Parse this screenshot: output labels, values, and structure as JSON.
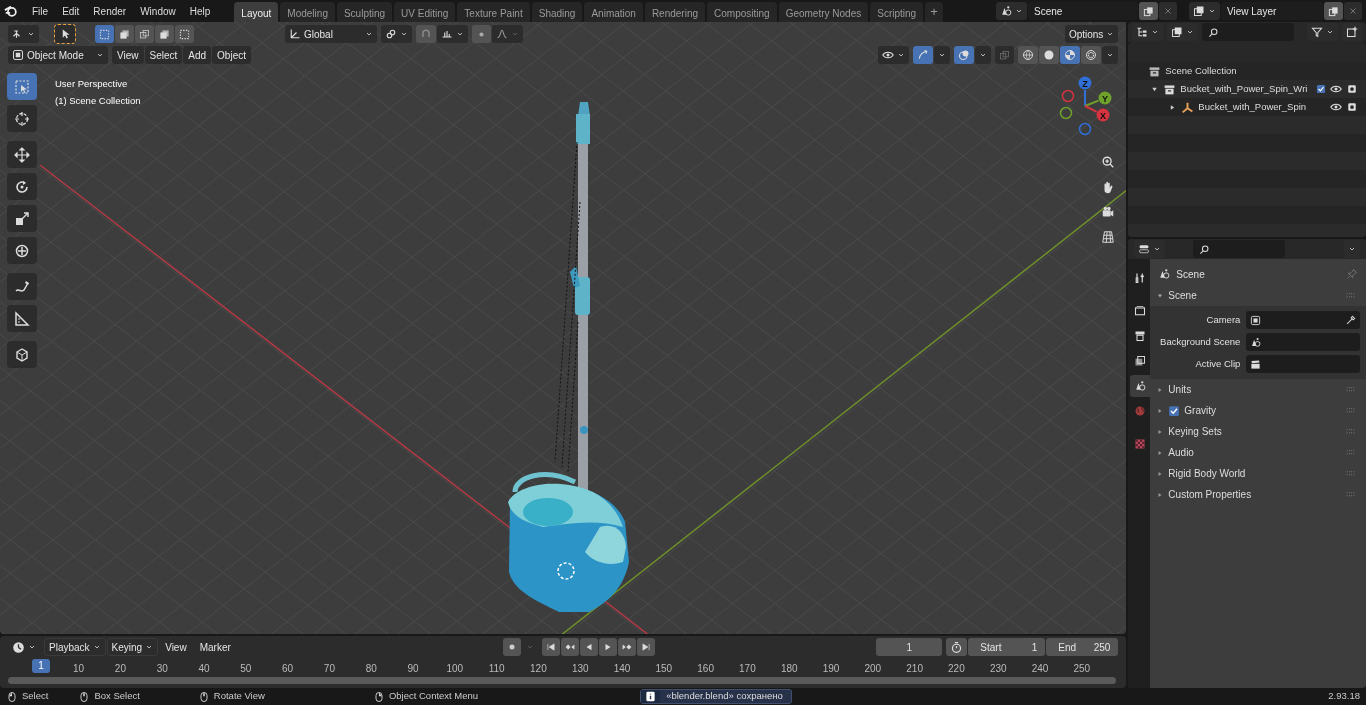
{
  "menu": [
    "File",
    "Edit",
    "Render",
    "Window",
    "Help"
  ],
  "workspaces": [
    {
      "label": "Layout",
      "selected": true
    },
    {
      "label": "Modeling",
      "selected": false
    },
    {
      "label": "Sculpting",
      "selected": false
    },
    {
      "label": "UV Editing",
      "selected": false
    },
    {
      "label": "Texture Paint",
      "selected": false
    },
    {
      "label": "Shading",
      "selected": false
    },
    {
      "label": "Animation",
      "selected": false
    },
    {
      "label": "Rendering",
      "selected": false
    },
    {
      "label": "Compositing",
      "selected": false
    },
    {
      "label": "Geometry Nodes",
      "selected": false
    },
    {
      "label": "Scripting",
      "selected": false
    }
  ],
  "add_workspace": "+",
  "scene": "Scene",
  "view_layer": "View Layer",
  "viewport": {
    "select_modes": [
      {
        "selected": true
      },
      {
        "selected": false
      },
      {
        "selected": false
      },
      {
        "selected": false
      },
      {
        "selected": false
      }
    ],
    "orientation": "Global",
    "options": "Options",
    "mode": "Object Mode",
    "menus": [
      "View",
      "Select",
      "Add",
      "Object"
    ],
    "shading": [
      {
        "selected": false
      },
      {
        "selected": false
      },
      {
        "selected": true
      },
      {
        "selected": false
      }
    ],
    "info": [
      "User Perspective",
      "(1) Scene Collection"
    ],
    "tools": [
      {
        "kind": "select",
        "selected": true
      },
      {
        "kind": "cursor",
        "selected": false
      },
      {
        "kind": "move",
        "selected": false
      },
      {
        "kind": "rotate",
        "selected": false
      },
      {
        "kind": "scale",
        "selected": false
      },
      {
        "kind": "transform",
        "selected": false
      },
      {
        "kind": "annotate",
        "selected": false
      },
      {
        "kind": "measure",
        "selected": false
      },
      {
        "kind": "addcube",
        "selected": false
      }
    ],
    "axes": [
      {
        "label": "Z",
        "color": "#2f6fd6"
      },
      {
        "label": "Y",
        "color": "#6ea22a"
      },
      {
        "label": "X",
        "color": "#d4333f"
      }
    ]
  },
  "outliner": {
    "root": "Scene Collection",
    "children": [
      {
        "label": "Bucket_with_Power_Spin_Wri",
        "kind": "collection",
        "expanded": true,
        "checked": true,
        "children": [
          {
            "label": "Bucket_with_Power_Spin",
            "kind": "object",
            "expanded": false
          }
        ]
      }
    ]
  },
  "properties": {
    "tabs": [
      {
        "kind": "tool",
        "selected": false
      },
      {
        "kind": "render",
        "selected": false
      },
      {
        "kind": "output",
        "selected": false
      },
      {
        "kind": "viewlayer",
        "selected": false
      },
      {
        "kind": "scene",
        "selected": true
      },
      {
        "kind": "world",
        "selected": false
      },
      {
        "kind": "texture",
        "selected": false
      }
    ],
    "context": "Scene",
    "panel": {
      "title": "Scene",
      "expanded": true,
      "fields": [
        {
          "label": "Camera",
          "kind": "camera"
        },
        {
          "label": "Background Scene",
          "kind": "scene"
        },
        {
          "label": "Active Clip",
          "kind": "clip"
        }
      ]
    },
    "sections": [
      {
        "label": "Units",
        "kind": "plain"
      },
      {
        "label": "Gravity",
        "kind": "checkbox",
        "checked": true
      },
      {
        "label": "Keying Sets",
        "kind": "plain"
      },
      {
        "label": "Audio",
        "kind": "plain"
      },
      {
        "label": "Rigid Body World",
        "kind": "plain"
      },
      {
        "label": "Custom Properties",
        "kind": "plain"
      }
    ]
  },
  "timeline": {
    "menus": [
      {
        "label": "Playback",
        "kind": "dropdown"
      },
      {
        "label": "Keying",
        "kind": "dropdown"
      },
      {
        "label": "View",
        "kind": "menu"
      },
      {
        "label": "Marker",
        "kind": "menu"
      }
    ],
    "current_frame": "1",
    "start_label": "Start",
    "start": "1",
    "end_label": "End",
    "end": "250",
    "playhead": "1",
    "ruler": [
      "10",
      "20",
      "30",
      "40",
      "50",
      "60",
      "70",
      "80",
      "90",
      "100",
      "110",
      "120",
      "130",
      "140",
      "150",
      "160",
      "170",
      "180",
      "190",
      "200",
      "210",
      "220",
      "230",
      "240",
      "250"
    ]
  },
  "status_bar": {
    "hints": [
      "Select",
      "Box Select",
      "Rotate View",
      "Object Context Menu"
    ],
    "message": "«blender.blend» сохранено",
    "version": "2.93.18"
  }
}
